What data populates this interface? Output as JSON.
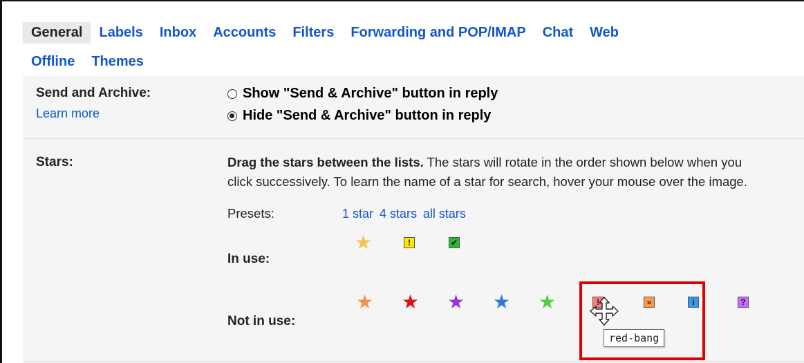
{
  "tabs_row1": [
    "General",
    "Labels",
    "Inbox",
    "Accounts",
    "Filters",
    "Forwarding and POP/IMAP",
    "Chat",
    "Web"
  ],
  "tabs_row2": [
    "Offline",
    "Themes"
  ],
  "send_archive": {
    "label": "Send and Archive:",
    "learn_more": "Learn more",
    "option_show": "Show \"Send & Archive\" button in reply",
    "option_hide": "Hide \"Send & Archive\" button in reply",
    "selected": "hide"
  },
  "stars": {
    "label": "Stars:",
    "instruction_bold": "Drag the stars between the lists.",
    "instruction_rest": " The stars will rotate in the order shown below when you",
    "instruction_line2": "click successively. To learn the name of a star for search, hover your mouse over the image.",
    "presets_label": "Presets:",
    "presets": [
      "1 star",
      "4 stars",
      "all stars"
    ],
    "in_use_label": "In use:",
    "not_in_use_label": "Not in use:",
    "in_use": [
      {
        "name": "yellow-star",
        "kind": "star",
        "color": "#f4c64e"
      },
      {
        "name": "yellow-bang",
        "kind": "square",
        "bg": "#ffe600",
        "glyph": "!"
      },
      {
        "name": "green-check",
        "kind": "square",
        "bg": "#22bb33",
        "glyph": "✔"
      }
    ],
    "not_in_use": [
      {
        "name": "orange-star",
        "kind": "star",
        "color": "#f7924a"
      },
      {
        "name": "red-star",
        "kind": "star",
        "color": "#dd1111"
      },
      {
        "name": "purple-star",
        "kind": "star",
        "color": "#9933dd"
      },
      {
        "name": "blue-star",
        "kind": "star",
        "color": "#3377dd"
      },
      {
        "name": "green-star",
        "kind": "star",
        "color": "#55cc44"
      },
      {
        "name": "red-bang",
        "kind": "square",
        "bg": "#ff7777",
        "glyph": "!"
      },
      {
        "name": "orange-guillemet",
        "kind": "square",
        "bg": "#ff9944",
        "glyph": "»"
      },
      {
        "name": "blue-info",
        "kind": "square",
        "bg": "#3399ee",
        "glyph": "i"
      },
      {
        "name": "purple-question",
        "kind": "square",
        "bg": "#cc66ff",
        "glyph": "?"
      }
    ]
  },
  "tooltip": "red-bang",
  "colors": {
    "link": "#1155cc",
    "highlight": "#e00000",
    "panel": "#f5f5f5"
  }
}
